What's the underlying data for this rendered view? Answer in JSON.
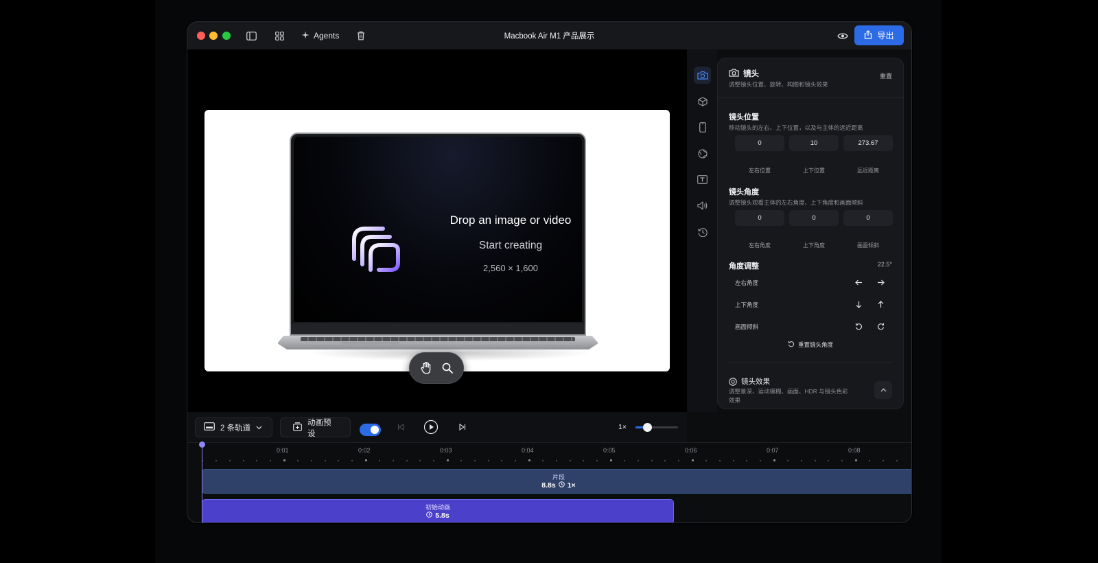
{
  "window": {
    "title": "Macbook Air M1 产品展示",
    "agents_label": "Agents",
    "export_label": "导出"
  },
  "canvas": {
    "drop_title": "Drop an image or video",
    "drop_subtitle": "Start creating",
    "drop_size": "2,560 × 1,600"
  },
  "panel": {
    "title": "镜头",
    "subtitle": "调整镜头位置、旋转、构图和镜头效果",
    "reset_label": "重置",
    "position": {
      "title": "镜头位置",
      "subtitle": "移动镜头的左右、上下位置，以及与主体的远近距离",
      "values": [
        "0",
        "10",
        "273.67"
      ],
      "labels": [
        "左右位置",
        "上下位置",
        "远近距离"
      ]
    },
    "angle": {
      "title": "镜头角度",
      "subtitle": "调整镜头观看主体的左右角度、上下角度和画面倾斜",
      "values": [
        "0",
        "0",
        "0"
      ],
      "labels": [
        "左右角度",
        "上下角度",
        "画面倾斜"
      ]
    },
    "adjust": {
      "title": "角度调整",
      "step": "22.5°",
      "rows": [
        "左右角度",
        "上下角度",
        "画面倾斜"
      ],
      "reset_label": "重置镜头角度"
    },
    "effects": {
      "title": "镜头效果",
      "subtitle": "调整景深、运动模糊、画面、HDR 与镜头色彩效果"
    }
  },
  "toolbar": {
    "tracks_label": "2 条轨道",
    "preset_label": "动画预设",
    "toggle_on": true,
    "speed_label": "1×",
    "zoom_level": 0.28
  },
  "timeline": {
    "ticks": [
      "0:01",
      "0:02",
      "0:03",
      "0:04",
      "0:05",
      "0:06",
      "0:07",
      "0:08"
    ],
    "clip": {
      "label": "片段",
      "duration": "8.8s",
      "speed": "1×"
    },
    "animation": {
      "label": "初始动画",
      "duration": "5.8s"
    }
  },
  "colors": {
    "accent": "#2d6be6",
    "clip_track": "#2f4168",
    "animation_track": "#4b40c9",
    "playhead": "#8e86f2"
  }
}
